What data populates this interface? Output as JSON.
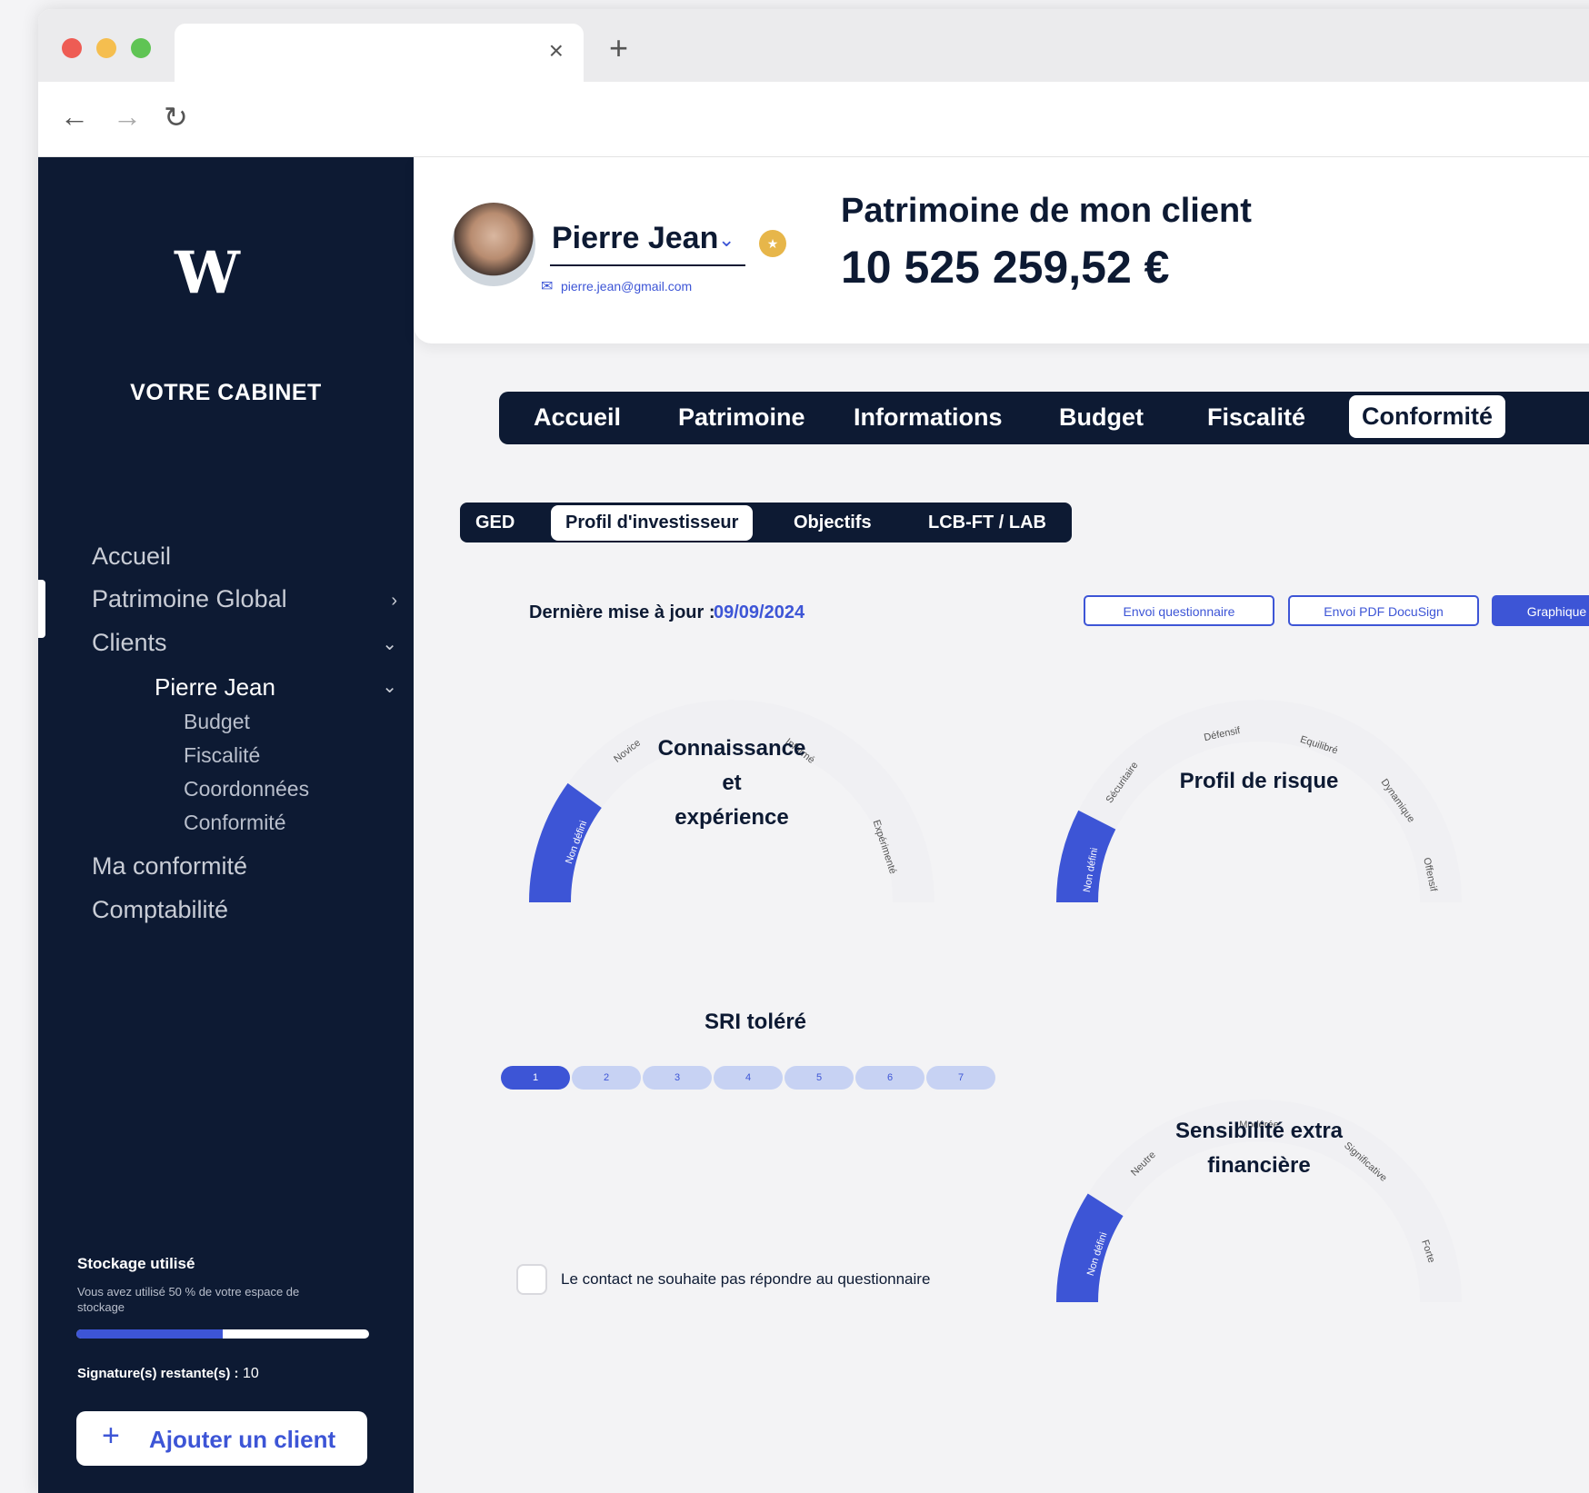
{
  "browser": {
    "close_glyph": "×",
    "new_tab_glyph": "+",
    "back_glyph": "←",
    "forward_glyph": "→",
    "reload_glyph": "↻"
  },
  "sidebar": {
    "logo": "W",
    "cabinet": "VOTRE CABINET",
    "items": [
      {
        "label": "Accueil"
      },
      {
        "label": "Patrimoine Global"
      },
      {
        "label": "Clients"
      },
      {
        "label": "Pierre Jean"
      },
      {
        "label": "Budget"
      },
      {
        "label": "Fiscalité"
      },
      {
        "label": "Coordonnées"
      },
      {
        "label": "Conformité"
      },
      {
        "label": "Ma conformité"
      },
      {
        "label": "Comptabilité"
      }
    ],
    "storage": {
      "title": "Stockage utilisé",
      "description": "Vous avez utilisé 50 % de votre espace de stockage",
      "used_fraction": 0.5
    },
    "signatures_label": "Signature(s) restante(s) :",
    "signatures_value": "10",
    "add_client_plus": "+",
    "add_client": "Ajouter un client"
  },
  "header": {
    "client_name": "Pierre Jean",
    "client_email": "pierre.jean@gmail.com",
    "patrimoine_title": "Patrimoine de mon client",
    "patrimoine_value": "10 525 259,52 €"
  },
  "main_tabs": [
    "Accueil",
    "Patrimoine",
    "Informations",
    "Budget",
    "Fiscalité",
    "Conformité"
  ],
  "sub_tabs": [
    "GED",
    "Profil d'investisseur",
    "Objectifs",
    "LCB-FT / LAB"
  ],
  "update": {
    "label": "Dernière mise à jour :",
    "date": "09/09/2024"
  },
  "actions": {
    "send_questionnaire": "Envoi questionnaire",
    "send_pdf": "Envoi PDF DocuSign",
    "graph": "Graphique"
  },
  "gauges": {
    "connaissance": {
      "title_line1": "Connaissance",
      "title_line2": "et",
      "title_line3": "expérience",
      "levels": [
        "Non défini",
        "Novice",
        "Informé",
        "Expérimenté"
      ],
      "selected": "Non défini"
    },
    "risque": {
      "title": "Profil de risque",
      "levels": [
        "Non défini",
        "Sécuritaire",
        "Défensif",
        "Equilibré",
        "Dynamique",
        "Offensif"
      ],
      "selected": "Non défini"
    },
    "sensibilite": {
      "title_line1": "Sensibilité extra",
      "title_line2": "financière",
      "levels": [
        "Non défini",
        "Neutre",
        "Modérée",
        "Significative",
        "Forte"
      ],
      "selected": "Non défini"
    }
  },
  "sri": {
    "title": "SRI toléré",
    "values": [
      "1",
      "2",
      "3",
      "4",
      "5",
      "6",
      "7"
    ],
    "selected": "1"
  },
  "no_answer_label": "Le contact ne souhaite pas répondre au questionnaire",
  "colors": {
    "navy": "#0d1a33",
    "accent": "#3d55d6"
  }
}
